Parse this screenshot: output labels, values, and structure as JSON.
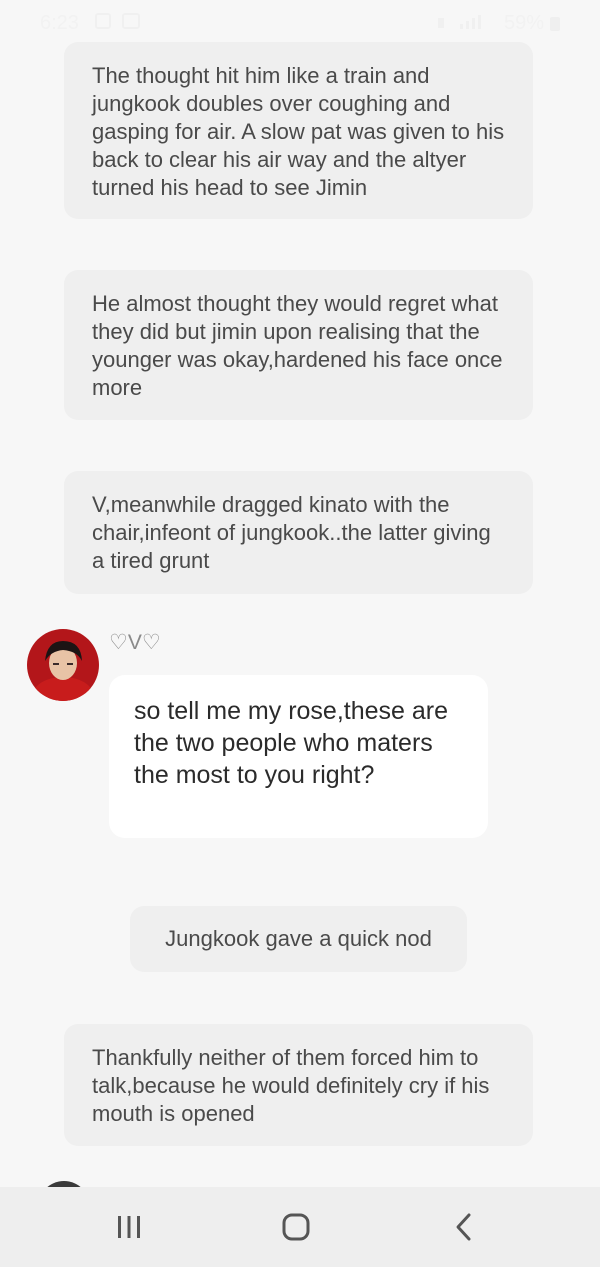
{
  "status_bar": {
    "time": "6:23",
    "battery": "59%"
  },
  "chat": {
    "narrations": [
      "The thought hit him like a train and jungkook doubles over coughing and gasping for air. A slow pat was given to his back to clear his air way and the altyer turned his head to see Jimin",
      "He almost thought they would regret what they did but jimin upon realising that the younger was okay,hardened his face once more",
      "V,meanwhile dragged kinato with the chair,infeont of jungkook..the latter giving a tired grunt",
      "Jungkook gave a quick nod",
      "Thankfully neither of them forced him to talk,because he would definitely cry if his mouth is opened"
    ],
    "speaker": {
      "name": "♡V♡",
      "message": "so tell me my rose,these are the two people who maters the most to you right?"
    }
  },
  "colors": {
    "background": "#f7f7f7",
    "narration_bubble": "#efefef",
    "speech_bubble": "#ffffff",
    "avatar_accent": "#b3161a",
    "nav_bar": "#eeeeee"
  }
}
